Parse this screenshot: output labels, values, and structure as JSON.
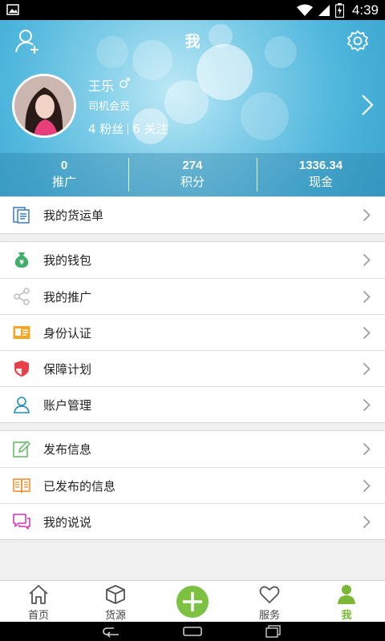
{
  "status_bar": {
    "time": "4:39"
  },
  "header": {
    "title": "我",
    "user": {
      "name": "王乐",
      "member_label": "司机会员",
      "fans": "4 粉丝",
      "following": "6 关注"
    },
    "stats": [
      {
        "value": "0",
        "label": "推广"
      },
      {
        "value": "274",
        "label": "积分"
      },
      {
        "value": "1336.34",
        "label": "现金"
      }
    ]
  },
  "menu": {
    "group1": [
      {
        "label": "我的货运单",
        "icon": "waybill-icon"
      }
    ],
    "group2": [
      {
        "label": "我的钱包",
        "icon": "wallet-icon"
      },
      {
        "label": "我的推广",
        "icon": "share-icon"
      },
      {
        "label": "身份认证",
        "icon": "id-card-icon"
      },
      {
        "label": "保障计划",
        "icon": "shield-icon"
      },
      {
        "label": "账户管理",
        "icon": "user-icon"
      }
    ],
    "group3": [
      {
        "label": "发布信息",
        "icon": "edit-icon"
      },
      {
        "label": "已发布的信息",
        "icon": "book-icon"
      },
      {
        "label": "我的说说",
        "icon": "chat-icon"
      }
    ]
  },
  "bottom_nav": [
    {
      "label": "首页",
      "icon": "home-icon"
    },
    {
      "label": "货源",
      "icon": "box-icon"
    },
    {
      "label": "",
      "icon": "plus-icon"
    },
    {
      "label": "服务",
      "icon": "heart-icon"
    },
    {
      "label": "我",
      "icon": "person-icon",
      "active": true
    }
  ],
  "colors": {
    "accent_green": "#7bb833",
    "header_blue": "#4fb6dc"
  }
}
